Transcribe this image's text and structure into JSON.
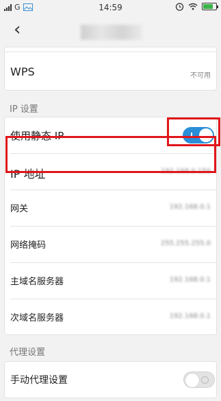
{
  "status_bar": {
    "network": "G",
    "time": "14:59"
  },
  "header": {
    "back_icon": "chevron-left-icon",
    "title": ""
  },
  "wps": {
    "label": "WPS",
    "value": "不可用"
  },
  "ip_settings": {
    "section_label": "IP 设置",
    "static_ip": {
      "label": "使用静态 IP",
      "enabled": true
    },
    "fields": [
      {
        "label": "IP 地址",
        "value": "192.168.0.150"
      },
      {
        "label": "网关",
        "value": "192.168.0.1"
      },
      {
        "label": "网络掩码",
        "value": "255.255.255.0"
      },
      {
        "label": "主域名服务器",
        "value": "192.168.0.1"
      },
      {
        "label": "次域名服务器",
        "value": "192.168.0.1"
      }
    ]
  },
  "proxy_settings": {
    "section_label": "代理设置",
    "manual_proxy": {
      "label": "手动代理设置",
      "enabled": false
    }
  },
  "colors": {
    "accent": "#2a8fd8",
    "highlight": "#e0161a",
    "background": "#f2f2f2"
  }
}
